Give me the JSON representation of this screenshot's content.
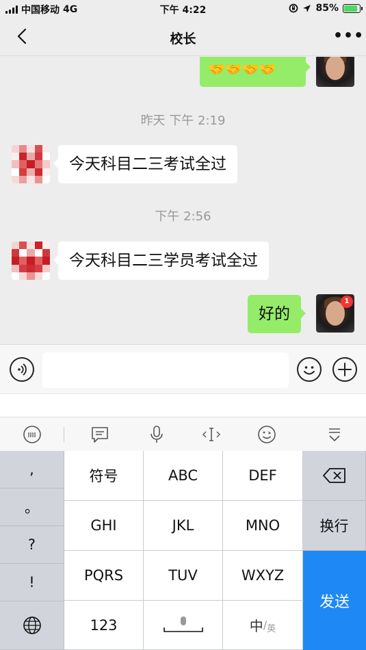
{
  "status_bar": {
    "carrier": "中国移动",
    "network": "4G",
    "time": "下午 4:22",
    "battery": "85%",
    "battery_level": 0.85
  },
  "nav": {
    "title": "校长",
    "more": "•••"
  },
  "messages": [
    {
      "type": "out",
      "text": "🤝🤝🤝🤝"
    },
    {
      "type": "time",
      "text": "昨天 下午 2:19"
    },
    {
      "type": "in",
      "text": "今天科目二三考试全过"
    },
    {
      "type": "time",
      "text": "下午 2:56"
    },
    {
      "type": "in",
      "text": "今天科目二三学员考试全过"
    },
    {
      "type": "out",
      "text": "好的"
    }
  ],
  "self_avatar_badge": "1",
  "keyboard": {
    "punct": [
      ",",
      "。",
      "?",
      "!"
    ],
    "row1": [
      "符号",
      "ABC",
      "DEF"
    ],
    "row2": [
      "GHI",
      "JKL",
      "MNO"
    ],
    "row3": [
      "PQRS",
      "TUV",
      "WXYZ"
    ],
    "num": "123",
    "lang_main": "中",
    "lang_sub": "英",
    "enter": "换行",
    "send": "发送"
  },
  "colors": {
    "bubble_out": "#95ec69",
    "send": "#1e88f5",
    "badge": "#f43530"
  }
}
